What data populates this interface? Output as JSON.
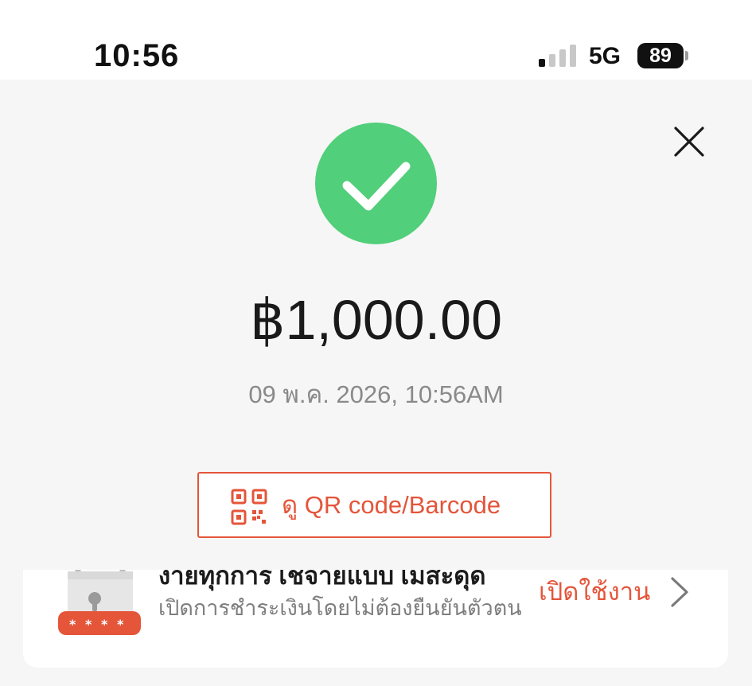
{
  "status_bar": {
    "time": "10:56",
    "network": "5G",
    "battery": "89"
  },
  "payment": {
    "amount": "฿1,000.00",
    "datetime": "09 พ.ค. 2026, 10:56AM",
    "qr_button_label": "ดู QR code/Barcode",
    "status_color": "#51cf7a"
  },
  "promo": {
    "title": "งายทุกการ เชจายแบบ เมสะดุด",
    "subtitle": "เปิดการชำระเงินโดยไม่ต้องยืนยันตัวตน",
    "action_label": "เปิดใช้งาน"
  },
  "colors": {
    "accent": "#e4553a",
    "success": "#51cf7a",
    "background": "#f6f6f6"
  },
  "icons": {
    "close": "close-icon",
    "success": "check-circle-icon",
    "qr": "qr-code-icon",
    "lock": "lock-icon",
    "chevron": "chevron-right-icon"
  }
}
